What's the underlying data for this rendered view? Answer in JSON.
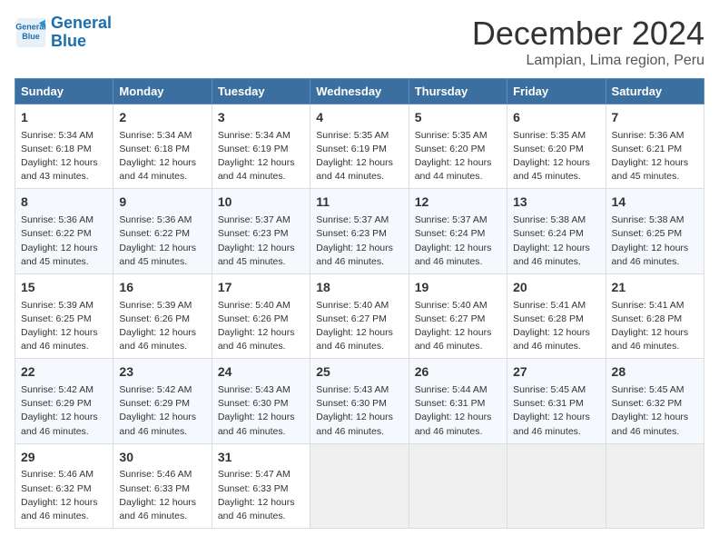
{
  "header": {
    "logo_line1": "General",
    "logo_line2": "Blue",
    "month": "December 2024",
    "location": "Lampian, Lima region, Peru"
  },
  "days_of_week": [
    "Sunday",
    "Monday",
    "Tuesday",
    "Wednesday",
    "Thursday",
    "Friday",
    "Saturday"
  ],
  "weeks": [
    [
      {
        "day": "1",
        "info": "Sunrise: 5:34 AM\nSunset: 6:18 PM\nDaylight: 12 hours\nand 43 minutes."
      },
      {
        "day": "2",
        "info": "Sunrise: 5:34 AM\nSunset: 6:18 PM\nDaylight: 12 hours\nand 44 minutes."
      },
      {
        "day": "3",
        "info": "Sunrise: 5:34 AM\nSunset: 6:19 PM\nDaylight: 12 hours\nand 44 minutes."
      },
      {
        "day": "4",
        "info": "Sunrise: 5:35 AM\nSunset: 6:19 PM\nDaylight: 12 hours\nand 44 minutes."
      },
      {
        "day": "5",
        "info": "Sunrise: 5:35 AM\nSunset: 6:20 PM\nDaylight: 12 hours\nand 44 minutes."
      },
      {
        "day": "6",
        "info": "Sunrise: 5:35 AM\nSunset: 6:20 PM\nDaylight: 12 hours\nand 45 minutes."
      },
      {
        "day": "7",
        "info": "Sunrise: 5:36 AM\nSunset: 6:21 PM\nDaylight: 12 hours\nand 45 minutes."
      }
    ],
    [
      {
        "day": "8",
        "info": "Sunrise: 5:36 AM\nSunset: 6:22 PM\nDaylight: 12 hours\nand 45 minutes."
      },
      {
        "day": "9",
        "info": "Sunrise: 5:36 AM\nSunset: 6:22 PM\nDaylight: 12 hours\nand 45 minutes."
      },
      {
        "day": "10",
        "info": "Sunrise: 5:37 AM\nSunset: 6:23 PM\nDaylight: 12 hours\nand 45 minutes."
      },
      {
        "day": "11",
        "info": "Sunrise: 5:37 AM\nSunset: 6:23 PM\nDaylight: 12 hours\nand 46 minutes."
      },
      {
        "day": "12",
        "info": "Sunrise: 5:37 AM\nSunset: 6:24 PM\nDaylight: 12 hours\nand 46 minutes."
      },
      {
        "day": "13",
        "info": "Sunrise: 5:38 AM\nSunset: 6:24 PM\nDaylight: 12 hours\nand 46 minutes."
      },
      {
        "day": "14",
        "info": "Sunrise: 5:38 AM\nSunset: 6:25 PM\nDaylight: 12 hours\nand 46 minutes."
      }
    ],
    [
      {
        "day": "15",
        "info": "Sunrise: 5:39 AM\nSunset: 6:25 PM\nDaylight: 12 hours\nand 46 minutes."
      },
      {
        "day": "16",
        "info": "Sunrise: 5:39 AM\nSunset: 6:26 PM\nDaylight: 12 hours\nand 46 minutes."
      },
      {
        "day": "17",
        "info": "Sunrise: 5:40 AM\nSunset: 6:26 PM\nDaylight: 12 hours\nand 46 minutes."
      },
      {
        "day": "18",
        "info": "Sunrise: 5:40 AM\nSunset: 6:27 PM\nDaylight: 12 hours\nand 46 minutes."
      },
      {
        "day": "19",
        "info": "Sunrise: 5:40 AM\nSunset: 6:27 PM\nDaylight: 12 hours\nand 46 minutes."
      },
      {
        "day": "20",
        "info": "Sunrise: 5:41 AM\nSunset: 6:28 PM\nDaylight: 12 hours\nand 46 minutes."
      },
      {
        "day": "21",
        "info": "Sunrise: 5:41 AM\nSunset: 6:28 PM\nDaylight: 12 hours\nand 46 minutes."
      }
    ],
    [
      {
        "day": "22",
        "info": "Sunrise: 5:42 AM\nSunset: 6:29 PM\nDaylight: 12 hours\nand 46 minutes."
      },
      {
        "day": "23",
        "info": "Sunrise: 5:42 AM\nSunset: 6:29 PM\nDaylight: 12 hours\nand 46 minutes."
      },
      {
        "day": "24",
        "info": "Sunrise: 5:43 AM\nSunset: 6:30 PM\nDaylight: 12 hours\nand 46 minutes."
      },
      {
        "day": "25",
        "info": "Sunrise: 5:43 AM\nSunset: 6:30 PM\nDaylight: 12 hours\nand 46 minutes."
      },
      {
        "day": "26",
        "info": "Sunrise: 5:44 AM\nSunset: 6:31 PM\nDaylight: 12 hours\nand 46 minutes."
      },
      {
        "day": "27",
        "info": "Sunrise: 5:45 AM\nSunset: 6:31 PM\nDaylight: 12 hours\nand 46 minutes."
      },
      {
        "day": "28",
        "info": "Sunrise: 5:45 AM\nSunset: 6:32 PM\nDaylight: 12 hours\nand 46 minutes."
      }
    ],
    [
      {
        "day": "29",
        "info": "Sunrise: 5:46 AM\nSunset: 6:32 PM\nDaylight: 12 hours\nand 46 minutes."
      },
      {
        "day": "30",
        "info": "Sunrise: 5:46 AM\nSunset: 6:33 PM\nDaylight: 12 hours\nand 46 minutes."
      },
      {
        "day": "31",
        "info": "Sunrise: 5:47 AM\nSunset: 6:33 PM\nDaylight: 12 hours\nand 46 minutes."
      },
      null,
      null,
      null,
      null
    ]
  ]
}
